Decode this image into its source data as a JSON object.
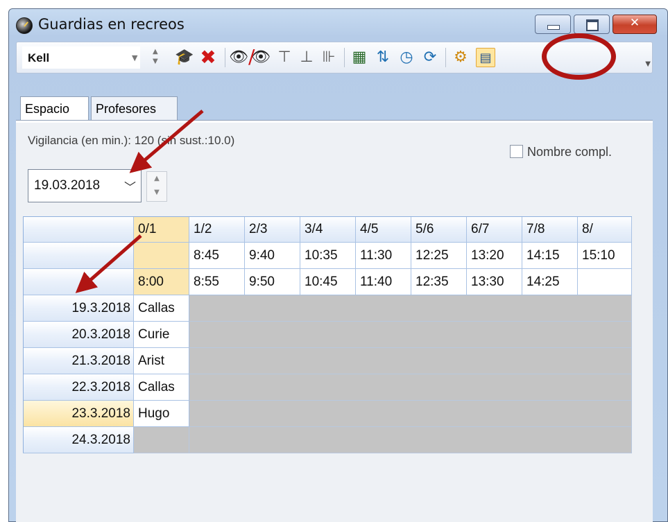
{
  "window": {
    "title": "Guardias en recreos"
  },
  "toolbar": {
    "teacher_value": "Kell",
    "icons": [
      "graduation-cap-icon",
      "delete-icon",
      "eye-icon",
      "eye-off-icon",
      "hierarchy-icon",
      "hierarchy-2-icon",
      "ruler-icon",
      "calculator-icon",
      "transfer-icon",
      "clock-icon",
      "refresh-icon",
      "settings-icon",
      "preview-icon"
    ]
  },
  "tabs": [
    {
      "label": "Espacio"
    },
    {
      "label": "Profesores"
    }
  ],
  "panel": {
    "vigilancia": "Vigilancia (en min.): 120 (sin sust.:10.0)",
    "date": "19.03.2018",
    "nombre_label": "Nombre compl."
  },
  "grid": {
    "period_labels": [
      "0/1",
      "1/2",
      "2/3",
      "3/4",
      "4/5",
      "5/6",
      "6/7",
      "7/8",
      "8/"
    ],
    "start_times": [
      "",
      "8:45",
      "9:40",
      "10:35",
      "11:30",
      "12:25",
      "13:20",
      "14:15",
      "15:10"
    ],
    "end_times": [
      "8:00",
      "8:55",
      "9:50",
      "10:45",
      "11:40",
      "12:35",
      "13:30",
      "14:25",
      ""
    ],
    "rows": [
      {
        "date": "19.3.2018",
        "teacher": "Callas"
      },
      {
        "date": "20.3.2018",
        "teacher": "Curie"
      },
      {
        "date": "21.3.2018",
        "teacher": "Arist"
      },
      {
        "date": "22.3.2018",
        "teacher": "Callas"
      },
      {
        "date": "23.3.2018",
        "teacher": "Hugo"
      },
      {
        "date": "24.3.2018",
        "teacher": ""
      }
    ]
  },
  "colors": {
    "highlight": "#fbe7b1",
    "annotation": "#b01513",
    "empty_cell": "#c4c4c4"
  }
}
